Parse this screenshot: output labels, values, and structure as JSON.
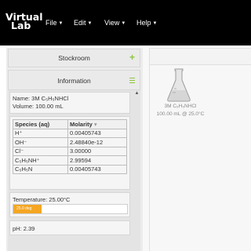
{
  "app": {
    "brand_line1": "Virtual",
    "brand_line2": "Lab"
  },
  "menu": [
    {
      "label": "File"
    },
    {
      "label": "Edit"
    },
    {
      "label": "View"
    },
    {
      "label": "Help"
    }
  ],
  "stockroom": {
    "title": "Stockroom",
    "icon": "plus-icon"
  },
  "information": {
    "title": "Information",
    "icon": "hamburger-icon",
    "name": "Name: 3M C₅H₅NHCl",
    "volume": "Volume: 100.00 mL",
    "table": {
      "headers": [
        "Species (aq)",
        "Molarity"
      ],
      "rows": [
        {
          "species": "H⁺",
          "molarity": "0.00405743"
        },
        {
          "species": "OH⁻",
          "molarity": "2.48840e-12"
        },
        {
          "species": "Cl⁻",
          "molarity": "3.00000"
        },
        {
          "species": "C₅H₅NH⁺",
          "molarity": "2.99594"
        },
        {
          "species": "C₅H₅N",
          "molarity": "0.00405743"
        }
      ]
    },
    "temperature_label": "Temperature: 25.00°C",
    "slider_text": "25.0 deg",
    "slider_fraction": 0.25,
    "ph": "pH: 2.39"
  },
  "workbench": {
    "flask_name": "3M C₅H₅NHCl",
    "flask_detail": "100.00 mL @ 25.0°C"
  },
  "colors": {
    "navbar": "#000000",
    "accent_green": "#8cc63f",
    "slider_orange": "#f5a623"
  }
}
